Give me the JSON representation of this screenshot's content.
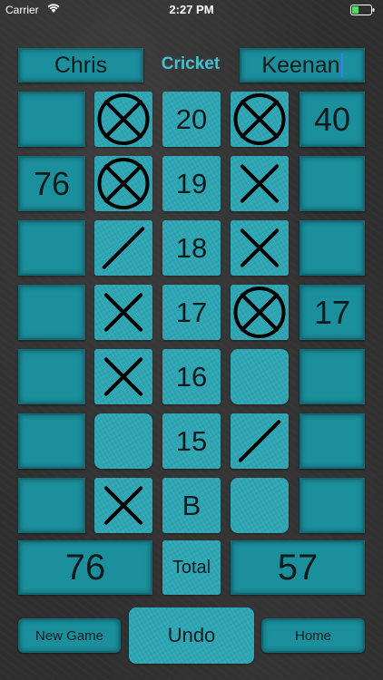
{
  "status_bar": {
    "carrier": "Carrier",
    "time": "2:27 PM"
  },
  "header": {
    "player1": "Chris",
    "game": "Cricket",
    "player2": "Keenan"
  },
  "rows": [
    {
      "label": "20",
      "p1_score": "",
      "p1_mark": "circle-x",
      "p2_mark": "circle-x",
      "p2_score": "40"
    },
    {
      "label": "19",
      "p1_score": "76",
      "p1_mark": "circle-x",
      "p2_mark": "x",
      "p2_score": ""
    },
    {
      "label": "18",
      "p1_score": "",
      "p1_mark": "slash",
      "p2_mark": "x",
      "p2_score": ""
    },
    {
      "label": "17",
      "p1_score": "",
      "p1_mark": "x",
      "p2_mark": "circle-x",
      "p2_score": "17"
    },
    {
      "label": "16",
      "p1_score": "",
      "p1_mark": "x",
      "p2_mark": "none",
      "p2_score": ""
    },
    {
      "label": "15",
      "p1_score": "",
      "p1_mark": "none",
      "p2_mark": "slash",
      "p2_score": ""
    },
    {
      "label": "B",
      "p1_score": "",
      "p1_mark": "x",
      "p2_mark": "none",
      "p2_score": ""
    }
  ],
  "totals": {
    "p1": "76",
    "label": "Total",
    "p2": "57"
  },
  "buttons": {
    "new_game": "New Game",
    "undo": "Undo",
    "home": "Home"
  },
  "colors": {
    "tile": "#1b8f9c",
    "tile_light": "#2ea5b3",
    "accent": "#45c2d0",
    "background": "#2e2e2f"
  }
}
